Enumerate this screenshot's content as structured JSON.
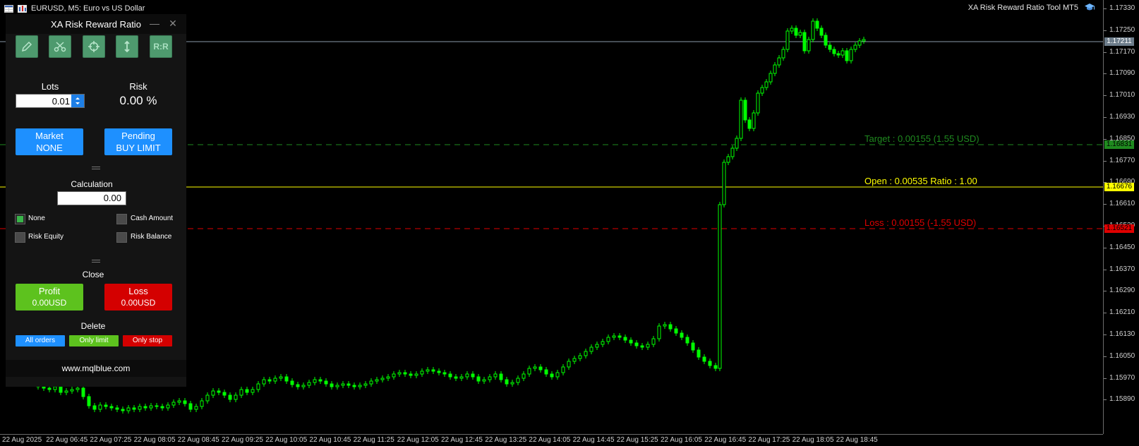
{
  "chart": {
    "symbol_title": "EURUSD, M5:  Euro vs US Dollar",
    "indicator_title": "XA Risk Reward Ratio Tool MT5",
    "price_ticks": [
      "1.17330",
      "1.17250",
      "1.17170",
      "1.17090",
      "1.17010",
      "1.16930",
      "1.16850",
      "1.16770",
      "1.16690",
      "1.16610",
      "1.16530",
      "1.16450",
      "1.16370",
      "1.16290",
      "1.16210",
      "1.16130",
      "1.16050",
      "1.15970",
      "1.15890"
    ],
    "current_price": "1.17211",
    "target_price": "1.16831",
    "open_price": "1.16676",
    "loss_price": "1.16521",
    "time_ticks": [
      "22 Aug 2025",
      "22 Aug 06:45",
      "22 Aug 07:25",
      "22 Aug 08:05",
      "22 Aug 08:45",
      "22 Aug 09:25",
      "22 Aug 10:05",
      "22 Aug 10:45",
      "22 Aug 11:25",
      "22 Aug 12:05",
      "22 Aug 12:45",
      "22 Aug 13:25",
      "22 Aug 14:05",
      "22 Aug 14:45",
      "22 Aug 15:25",
      "22 Aug 16:05",
      "22 Aug 16:45",
      "22 Aug 17:25",
      "22 Aug 18:05",
      "22 Aug 18:45"
    ],
    "target_label": "Target : 0.00155 (1.55 USD)",
    "open_label": "Open : 0.00535    Ratio : 1.00",
    "loss_label": "Loss : 0.00155 (-1.55 USD)",
    "colors": {
      "bull": "#00ff00",
      "target": "#1f8a1f",
      "open": "#ffff00",
      "loss": "#e00000",
      "current_line": "#8a9aa8"
    }
  },
  "panel": {
    "title": "XA Risk Reward Ratio",
    "minimize": "—",
    "close": "✕",
    "tools": [
      {
        "icon": "pencil-icon",
        "label": ""
      },
      {
        "icon": "scissors-icon",
        "label": ""
      },
      {
        "icon": "crosshair-icon",
        "label": ""
      },
      {
        "icon": "vertical-arrow-icon",
        "label": ""
      },
      {
        "icon": "rr-icon",
        "label": "R:R"
      }
    ],
    "lots_label": "Lots",
    "lots_value": "0.01",
    "risk_label": "Risk",
    "risk_value": "0.00 %",
    "market_label": "Market",
    "market_value": "NONE",
    "pending_label": "Pending",
    "pending_value": "BUY LIMIT",
    "calc_label": "Calculation",
    "calc_value": "0.00",
    "options": [
      {
        "label": "None",
        "checked": true
      },
      {
        "label": "Cash Amount",
        "checked": false
      },
      {
        "label": "Risk Equity",
        "checked": false
      },
      {
        "label": "Risk Balance",
        "checked": false
      }
    ],
    "close_label": "Close",
    "profit_label": "Profit",
    "profit_value": "0.00USD",
    "loss_label": "Loss",
    "loss_value": "0.00USD",
    "delete_label": "Delete",
    "delete_buttons": [
      "All orders",
      "Only limit",
      "Only stop"
    ],
    "footer": "www.mqlblue.com",
    "colors": {
      "blue": "#1e90ff",
      "green": "#5dc21e",
      "red": "#d40000",
      "tool": "#4e9a6e"
    }
  }
}
